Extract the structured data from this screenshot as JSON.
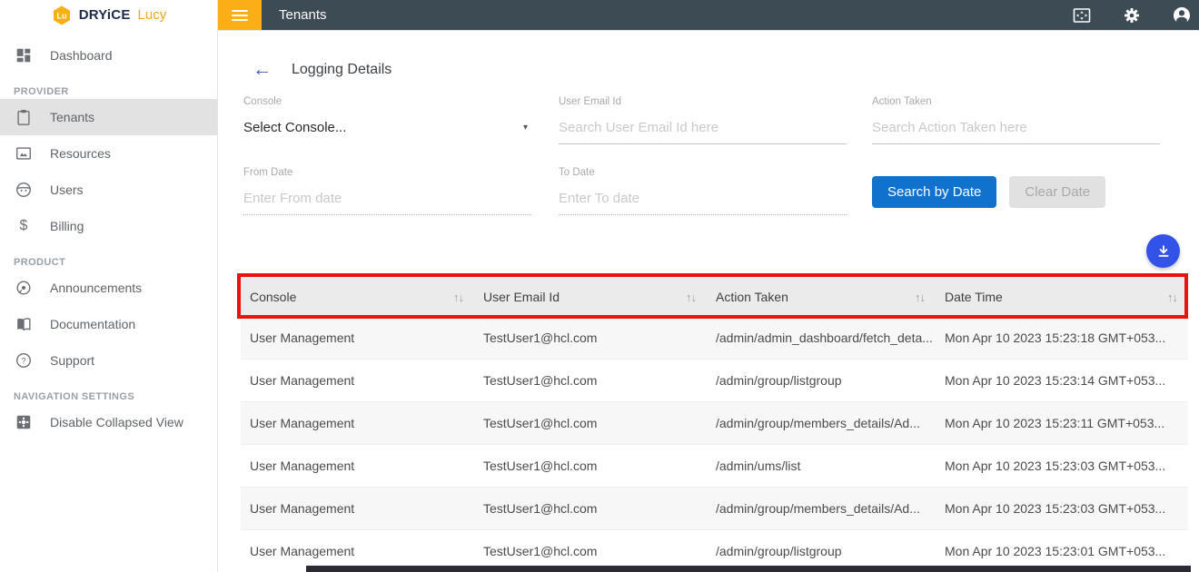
{
  "brand": {
    "logo_badge": "Lu",
    "name_primary": "DRYiCE",
    "name_secondary": "Lucy"
  },
  "topbar": {
    "title": "Tenants",
    "icons": [
      "fullscreen-icon",
      "settings-gear-icon",
      "account-icon"
    ]
  },
  "sidebar": {
    "dashboard": {
      "label": "Dashboard",
      "icon": "dashboard-icon"
    },
    "sections": [
      {
        "title": "PROVIDER",
        "items": [
          {
            "label": "Tenants",
            "icon": "clipboard-icon",
            "active": true
          },
          {
            "label": "Resources",
            "icon": "image-icon"
          },
          {
            "label": "Users",
            "icon": "face-icon"
          },
          {
            "label": "Billing",
            "icon": "dollar-icon"
          }
        ]
      },
      {
        "title": "PRODUCT",
        "items": [
          {
            "label": "Announcements",
            "icon": "speaker-icon"
          },
          {
            "label": "Documentation",
            "icon": "book-icon"
          },
          {
            "label": "Support",
            "icon": "help-icon"
          }
        ]
      },
      {
        "title": "NAVIGATION SETTINGS",
        "items": [
          {
            "label": "Disable Collapsed View",
            "icon": "collapse-settings-icon"
          }
        ]
      }
    ]
  },
  "page": {
    "title": "Logging Details"
  },
  "icons": {
    "back": "←",
    "caret": "▾",
    "sort": "↑↓",
    "dollar": "$",
    "help_mark": "?"
  },
  "filters": {
    "console": {
      "label": "Console",
      "value": "Select Console..."
    },
    "user_email": {
      "label": "User Email Id",
      "placeholder": "Search User Email Id here"
    },
    "action_taken": {
      "label": "Action Taken",
      "placeholder": "Search Action Taken here"
    },
    "from_date": {
      "label": "From Date",
      "placeholder": "Enter From date"
    },
    "to_date": {
      "label": "To Date",
      "placeholder": "Enter To date"
    },
    "search_button": "Search by Date",
    "clear_button": "Clear Date"
  },
  "table": {
    "columns": [
      "Console",
      "User Email Id",
      "Action Taken",
      "Date Time"
    ],
    "rows": [
      [
        "User Management",
        "TestUser1@hcl.com",
        "/admin/admin_dashboard/fetch_deta...",
        "Mon Apr 10 2023 15:23:18 GMT+053..."
      ],
      [
        "User Management",
        "TestUser1@hcl.com",
        "/admin/group/listgroup",
        "Mon Apr 10 2023 15:23:14 GMT+053..."
      ],
      [
        "User Management",
        "TestUser1@hcl.com",
        "/admin/group/members_details/Ad...",
        "Mon Apr 10 2023 15:23:11 GMT+053..."
      ],
      [
        "User Management",
        "TestUser1@hcl.com",
        "/admin/ums/list",
        "Mon Apr 10 2023 15:23:03 GMT+053..."
      ],
      [
        "User Management",
        "TestUser1@hcl.com",
        "/admin/group/members_details/Ad...",
        "Mon Apr 10 2023 15:23:03 GMT+053..."
      ],
      [
        "User Management",
        "TestUser1@hcl.com",
        "/admin/group/listgroup",
        "Mon Apr 10 2023 15:23:01 GMT+053..."
      ]
    ]
  },
  "colors": {
    "topbar": "#3d4b54",
    "amber": "#fcae17",
    "primary_blue": "#1172cd",
    "fab_blue": "#3353e8",
    "annotation_red": "#e8120f",
    "back_arrow_blue": "#3f51b5"
  }
}
